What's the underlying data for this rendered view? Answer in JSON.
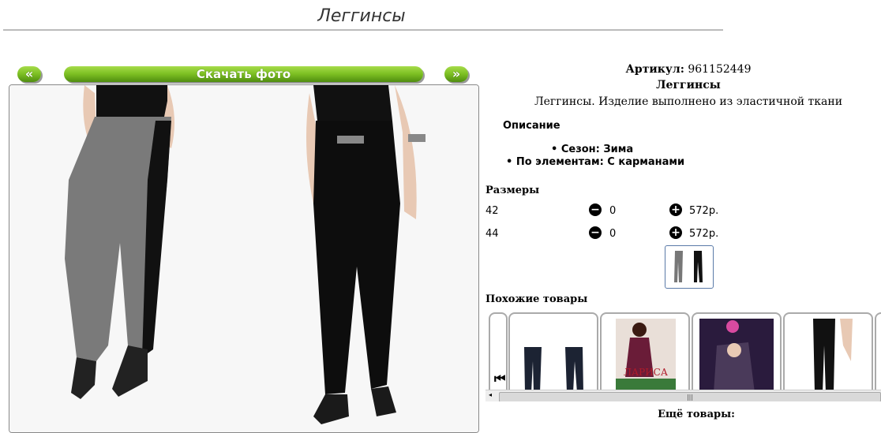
{
  "product": {
    "title": "Леггинсы",
    "article_label": "Артикул:",
    "article_value": "961152449",
    "name": "Леггинсы",
    "summary": "Леггинсы. Изделие выполнено из эластичной ткани"
  },
  "gallery": {
    "prev_label": "«",
    "download_label": "Скачать фото",
    "next_label": "»"
  },
  "description": {
    "heading": "Описание",
    "items": [
      "• Сезон: Зима",
      "• По элементам: С карманами"
    ]
  },
  "sizes": {
    "heading": "Размеры",
    "rows": [
      {
        "size": "42",
        "qty": "0",
        "price": "572р."
      },
      {
        "size": "44",
        "qty": "0",
        "price": "572р."
      }
    ]
  },
  "similar": {
    "heading": "Похожие товары",
    "card2_text": "ЛАРИСА"
  },
  "more": {
    "heading": "Ещё товары:"
  },
  "icons": {
    "minus": "minus-circle-icon",
    "plus": "plus-circle-icon",
    "prev": "skip-back-icon"
  },
  "colors": {
    "button_green": "#7cbf22"
  }
}
